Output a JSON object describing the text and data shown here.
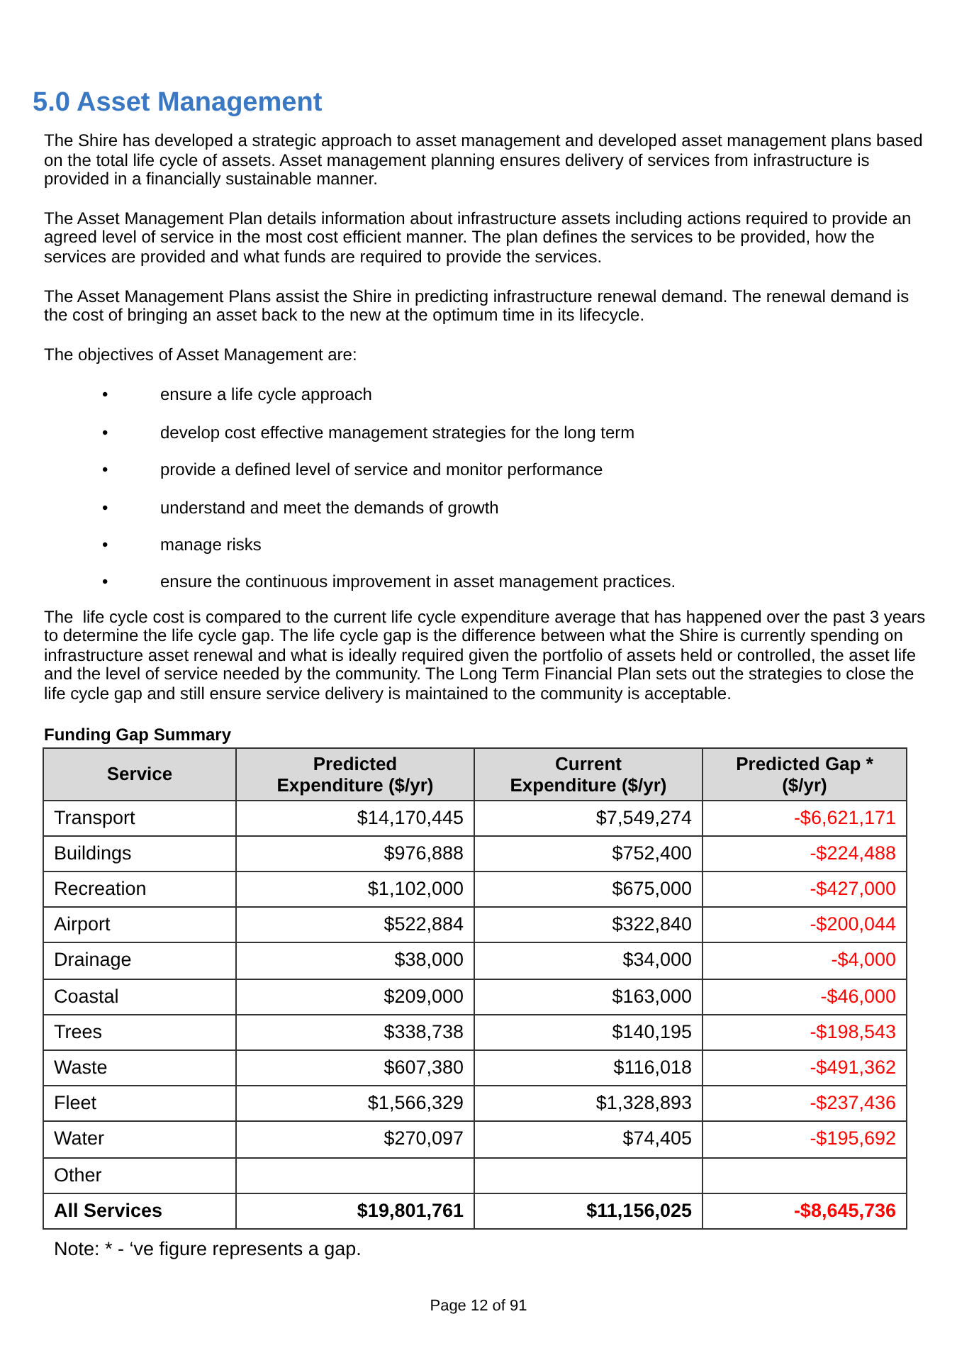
{
  "heading": "5.0 Asset Management",
  "intro_paragraphs": [
    "The Shire has developed a strategic approach to asset management and developed asset management plans based on the total life cycle of assets. Asset management planning ensures delivery of services from infrastructure is provided in a financially sustainable manner.",
    "The Asset Management Plan details information about infrastructure assets including actions required to provide an agreed level of service in the most cost efficient manner. The plan defines the services to be provided, how the services are provided and what funds are required to provide the services.",
    "The Asset Management Plans assist the Shire in predicting infrastructure renewal demand. The renewal demand is the cost of bringing an asset back to the new at the optimum time in its lifecycle.",
    "The objectives of Asset Management are:"
  ],
  "objectives": [
    {
      "bullet": "•",
      "text": "ensure a life cycle approach"
    },
    {
      "bullet": "•",
      "text": "develop cost effective management strategies for the long term"
    },
    {
      "bullet": "•",
      "text": "provide a defined level of service and monitor performance"
    },
    {
      "bullet": "•",
      "text": "understand and meet the demands of growth"
    },
    {
      "bullet": "•",
      "text": "manage risks"
    },
    {
      "bullet": "•",
      "text": "ensure the continuous improvement in asset management practices."
    }
  ],
  "closing_paragraph": "The  life cycle cost is compared to the current life cycle expenditure average that has happened over the past 3 years to determine the life cycle gap. The life cycle gap is the difference between what the Shire is currently spending on infrastructure asset renewal and what is ideally required given the portfolio of assets held or controlled, the asset life and the level of service needed by the community. The Long Term Financial Plan sets out the strategies to close the life cycle gap and still ensure service delivery is maintained to the community is acceptable.",
  "table_title": "Funding Gap Summary",
  "table": {
    "columns": [
      "Service",
      "Predicted Expenditure ($/yr)",
      "Current Expenditure ($/yr)",
      "Predicted Gap * ($/yr)"
    ],
    "rows": [
      {
        "kind": "item",
        "cells": [
          "Transport",
          "$14,170,445",
          "$7,549,274",
          "-$6,621,171"
        ]
      },
      {
        "kind": "item",
        "cells": [
          "Buildings",
          "$976,888",
          "$752,400",
          "-$224,488"
        ]
      },
      {
        "kind": "item",
        "cells": [
          "Recreation",
          "$1,102,000",
          "$675,000",
          "-$427,000"
        ]
      },
      {
        "kind": "item",
        "cells": [
          "Airport",
          "$522,884",
          "$322,840",
          "-$200,044"
        ]
      },
      {
        "kind": "item",
        "cells": [
          "Drainage",
          "$38,000",
          "$34,000",
          "-$4,000"
        ]
      },
      {
        "kind": "item",
        "cells": [
          "Coastal",
          "$209,000",
          "$163,000",
          "-$46,000"
        ]
      },
      {
        "kind": "item",
        "cells": [
          "Trees",
          "$338,738",
          "$140,195",
          "-$198,543"
        ]
      },
      {
        "kind": "item",
        "cells": [
          "Waste",
          "$607,380",
          "$116,018",
          "-$491,362"
        ]
      },
      {
        "kind": "item",
        "cells": [
          "Fleet",
          "$1,566,329",
          "$1,328,893",
          "-$237,436"
        ]
      },
      {
        "kind": "item",
        "cells": [
          "Water",
          "$270,097",
          "$74,405",
          "-$195,692"
        ]
      },
      {
        "kind": "item",
        "cells": [
          "Other"
        ]
      },
      {
        "kind": "total",
        "cells": [
          "All Services",
          "$19,801,761",
          "$11,156,025",
          "-$8,645,736"
        ]
      }
    ]
  },
  "note": "Note: * - ‘ve figure represents a gap.",
  "footer": "Page 12 of 91"
}
